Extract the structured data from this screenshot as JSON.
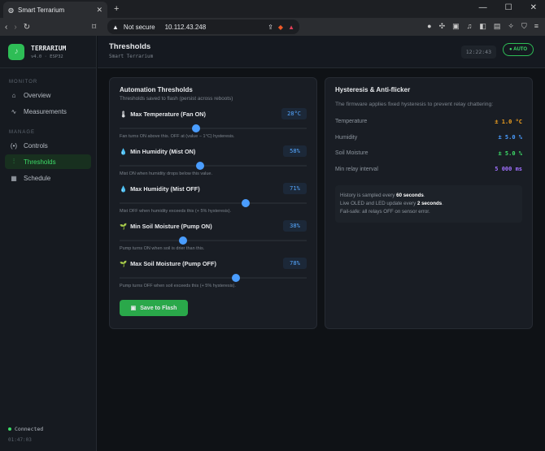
{
  "browser": {
    "tab_title": "Smart Terrarium",
    "security": "Not secure",
    "url": "10.112.43.248"
  },
  "brand": {
    "name": "TERRARIUM",
    "version": "v4.0 · ESP32"
  },
  "sidebar": {
    "sections": [
      {
        "label": "MONITOR",
        "items": [
          {
            "label": "Overview",
            "icon": "home-icon"
          },
          {
            "label": "Measurements",
            "icon": "pulse-icon"
          }
        ]
      },
      {
        "label": "MANAGE",
        "items": [
          {
            "label": "Controls",
            "icon": "radio-icon"
          },
          {
            "label": "Thresholds",
            "icon": "sliders-icon",
            "active": true
          },
          {
            "label": "Schedule",
            "icon": "calendar-icon"
          }
        ]
      }
    ],
    "status": "Connected",
    "uptime": "01:47:03"
  },
  "header": {
    "title": "Thresholds",
    "subtitle": "Smart Terrarium",
    "clock": "12:22:43",
    "mode": "AUTO"
  },
  "thresholds": {
    "title": "Automation Thresholds",
    "subtitle": "Thresholds saved to flash (persist across reboots)",
    "items": [
      {
        "icon": "🌡",
        "label": "Max Temperature (Fan ON)",
        "value": "28°C",
        "fraction": 0.41,
        "hint": "Fan turns ON above this. OFF at (value − 1°C) hysteresis."
      },
      {
        "icon": "💧",
        "label": "Min Humidity (Mist ON)",
        "value": "58%",
        "fraction": 0.43,
        "hint": "Mist ON when humidity drops below this value."
      },
      {
        "icon": "💧",
        "label": "Max Humidity (Mist OFF)",
        "value": "71%",
        "fraction": 0.675,
        "hint": "Mist OFF when humidity exceeds this (+ 5% hysteresis)."
      },
      {
        "icon": "🌱",
        "label": "Min Soil Moisture (Pump ON)",
        "value": "38%",
        "fraction": 0.34,
        "hint": "Pump turns ON when soil is drier than this."
      },
      {
        "icon": "🌱",
        "label": "Max Soil Moisture (Pump OFF)",
        "value": "78%",
        "fraction": 0.62,
        "hint": "Pump turns OFF when soil exceeds this (+ 5% hysteresis)."
      }
    ],
    "save_label": "Save to Flash"
  },
  "hysteresis": {
    "title": "Hysteresis & Anti-flicker",
    "subtitle": "The firmware applies fixed hysteresis to prevent relay chattering:",
    "rows": [
      {
        "label": "Temperature",
        "value": "± 1.0 °C",
        "color": "#f0a020"
      },
      {
        "label": "Humidity",
        "value": "± 5.0 %",
        "color": "#4a9dff"
      },
      {
        "label": "Soil Moisture",
        "value": "± 5.0 %",
        "color": "#3ddc68"
      },
      {
        "label": "Min relay interval",
        "value": "5 000 ms",
        "color": "#a070ff"
      }
    ],
    "note": {
      "l1_pre": "History is sampled every ",
      "l1_b": "60 seconds",
      "l2_pre": "Live OLED and LED update every ",
      "l2_b": "2 seconds",
      "l3": "Fail-safe: all relays OFF on sensor error."
    }
  }
}
